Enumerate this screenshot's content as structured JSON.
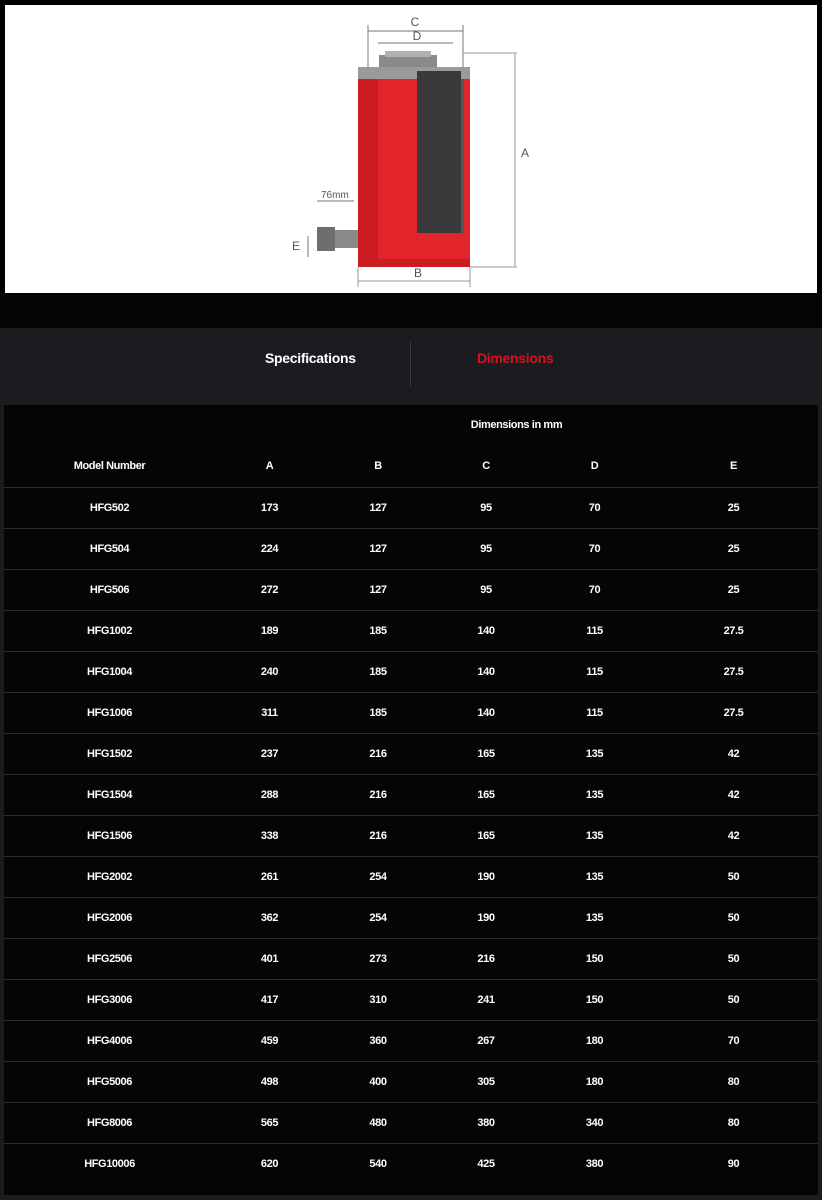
{
  "diagram": {
    "labels": {
      "a": "A",
      "b": "B",
      "c": "C",
      "d": "D",
      "e": "E",
      "port": "76mm"
    },
    "colors": {
      "cylinder": "#e3252b",
      "cutaway": "#3a3a3a",
      "steel": "#9a9a9a",
      "dim_line": "#777777"
    }
  },
  "tabs": {
    "specifications": "Specifications",
    "dimensions": "Dimensions",
    "active": "dimensions",
    "active_color": "#d4141c"
  },
  "table": {
    "group_header": "Dimensions in mm",
    "columns": [
      "Model Number",
      "A",
      "B",
      "C",
      "D",
      "E"
    ],
    "rows": [
      [
        "HFG502",
        "173",
        "127",
        "95",
        "70",
        "25"
      ],
      [
        "HFG504",
        "224",
        "127",
        "95",
        "70",
        "25"
      ],
      [
        "HFG506",
        "272",
        "127",
        "95",
        "70",
        "25"
      ],
      [
        "HFG1002",
        "189",
        "185",
        "140",
        "115",
        "27.5"
      ],
      [
        "HFG1004",
        "240",
        "185",
        "140",
        "115",
        "27.5"
      ],
      [
        "HFG1006",
        "311",
        "185",
        "140",
        "115",
        "27.5"
      ],
      [
        "HFG1502",
        "237",
        "216",
        "165",
        "135",
        "42"
      ],
      [
        "HFG1504",
        "288",
        "216",
        "165",
        "135",
        "42"
      ],
      [
        "HFG1506",
        "338",
        "216",
        "165",
        "135",
        "42"
      ],
      [
        "HFG2002",
        "261",
        "254",
        "190",
        "135",
        "50"
      ],
      [
        "HFG2006",
        "362",
        "254",
        "190",
        "135",
        "50"
      ],
      [
        "HFG2506",
        "401",
        "273",
        "216",
        "150",
        "50"
      ],
      [
        "HFG3006",
        "417",
        "310",
        "241",
        "150",
        "50"
      ],
      [
        "HFG4006",
        "459",
        "360",
        "267",
        "180",
        "70"
      ],
      [
        "HFG5006",
        "498",
        "400",
        "305",
        "180",
        "80"
      ],
      [
        "HFG8006",
        "565",
        "480",
        "380",
        "340",
        "80"
      ],
      [
        "HFG10006",
        "620",
        "540",
        "425",
        "380",
        "90"
      ]
    ]
  }
}
